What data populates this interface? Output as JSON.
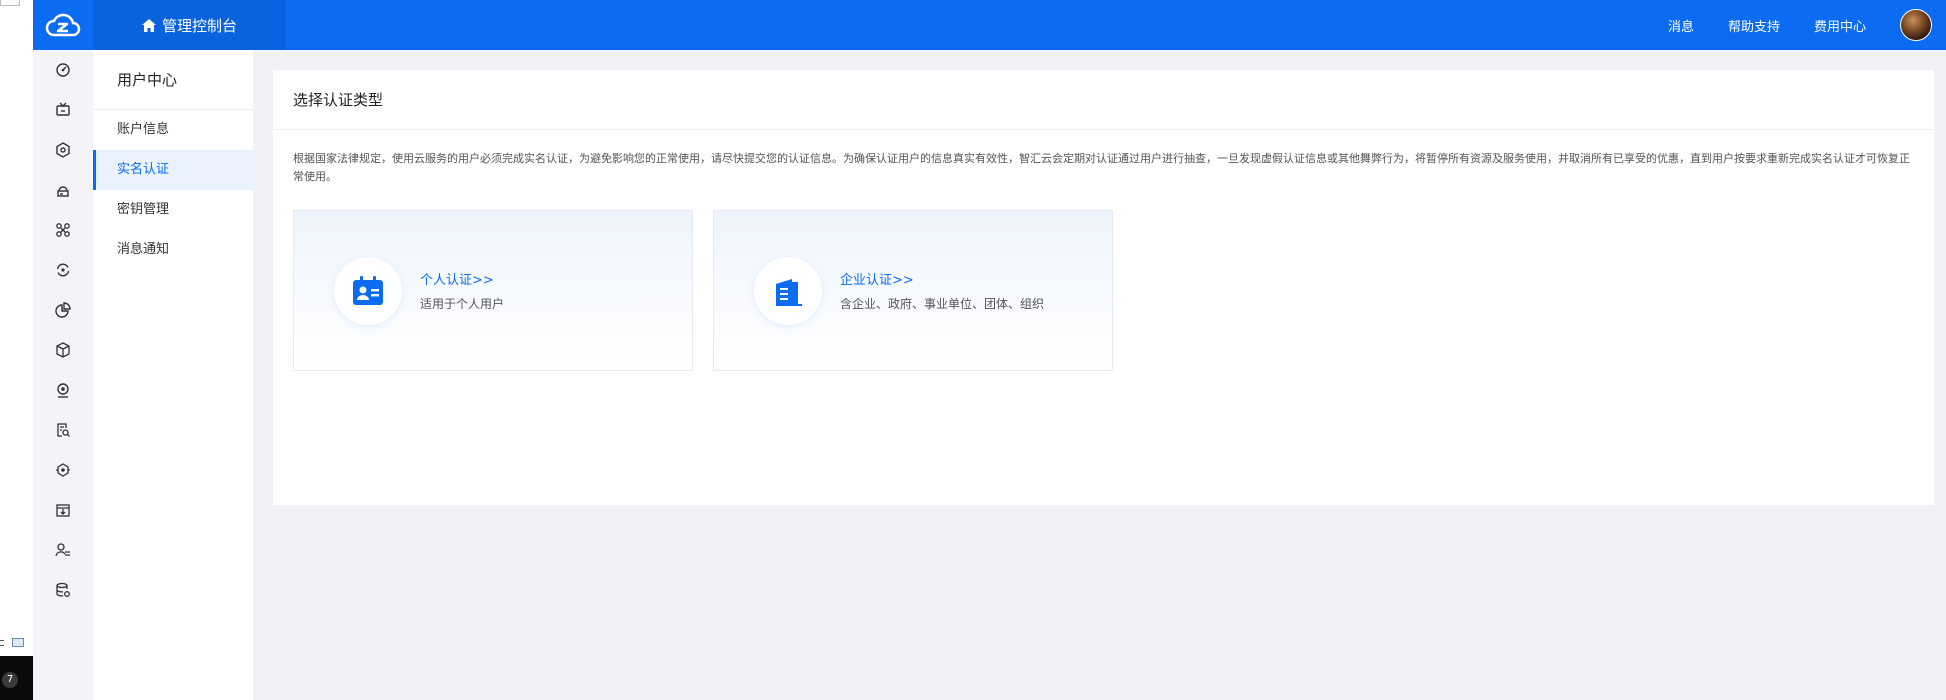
{
  "header": {
    "console_title": "管理控制台",
    "links": [
      "消息",
      "帮助支持",
      "费用中心"
    ],
    "brand_color": "#0b6cf2"
  },
  "icon_rail": {
    "icons": [
      "dashboard-icon",
      "monitor-icon",
      "hexagon-shield-icon",
      "cloud-host-icon",
      "network-icon",
      "sync-icon",
      "pie-chart-icon",
      "box-icon",
      "webcam-icon",
      "search-doc-icon",
      "cube-network-icon",
      "download-box-icon",
      "user-list-icon",
      "database-gear-icon"
    ]
  },
  "subnav": {
    "title": "用户中心",
    "items": [
      {
        "label": "账户信息",
        "active": false
      },
      {
        "label": "实名认证",
        "active": true
      },
      {
        "label": "密钥管理",
        "active": false
      },
      {
        "label": "消息通知",
        "active": false
      }
    ]
  },
  "main": {
    "title": "选择认证类型",
    "notice": "根据国家法律规定，使用云服务的用户必须完成实名认证，为避免影响您的正常使用，请尽快提交您的认证信息。为确保认证用户的信息真实有效性，智汇云会定期对认证通过用户进行抽查，一旦发现虚假认证信息或其他舞弊行为，将暂停所有资源及服务使用，并取消所有已享受的优惠，直到用户按要求重新完成实名认证才可恢复正常使用。",
    "options": [
      {
        "title": "个人认证>>",
        "desc": "适用于个人用户",
        "icon": "id-card-icon"
      },
      {
        "title": "企业认证>>",
        "desc": "含企业、政府、事业单位、团体、组织",
        "icon": "building-icon"
      }
    ]
  },
  "tray": {
    "badge": "7"
  }
}
